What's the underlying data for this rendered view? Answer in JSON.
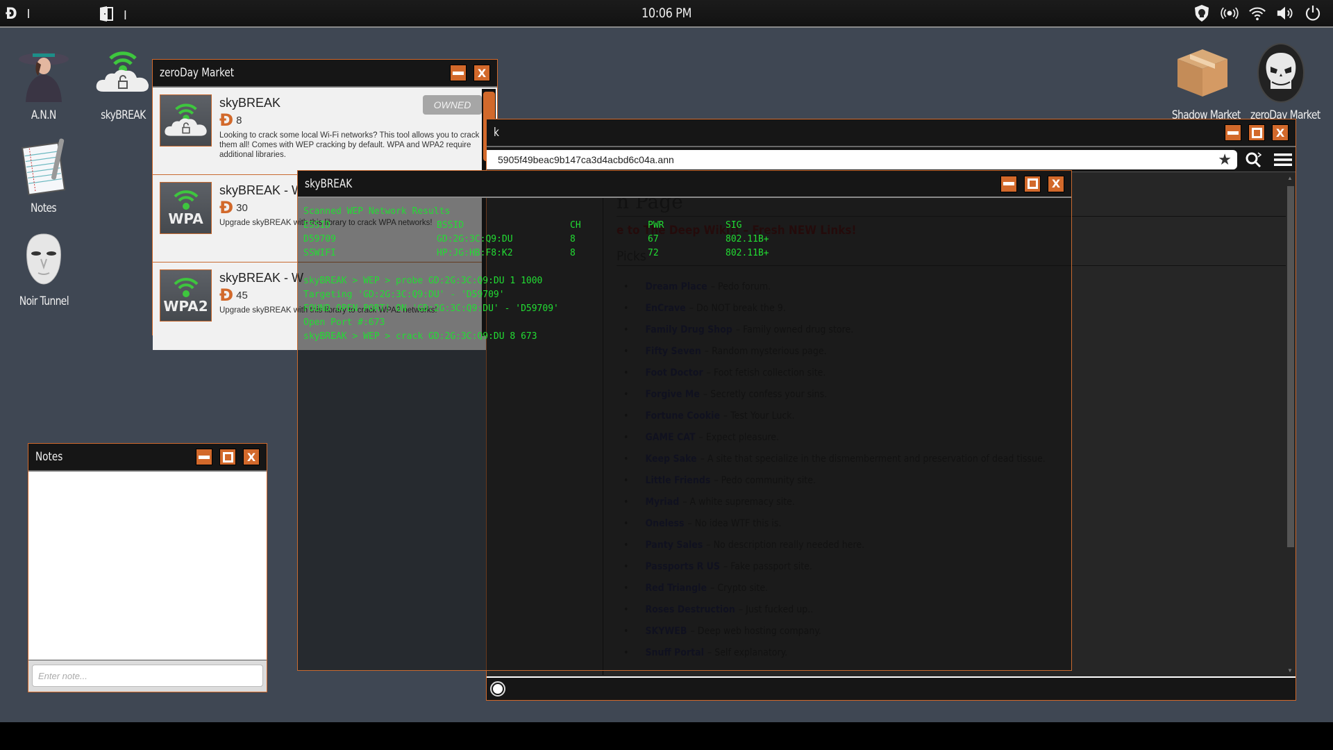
{
  "taskbar": {
    "left_items": [
      {
        "icon": "bitcoin-icon",
        "value": "I"
      },
      {
        "icon": "door-icon",
        "value": "I"
      }
    ],
    "clock": "10:06 PM",
    "tray_icons": [
      "shield-skull-icon",
      "broadcast-icon",
      "wifi-icon",
      "volume-icon",
      "power-icon"
    ]
  },
  "desktop": {
    "icons_left": [
      {
        "label": "A.N.N",
        "icon": "agent-icon"
      },
      {
        "label": "skyBREAK",
        "icon": "wifi-cloud-lock-icon"
      },
      {
        "label": "Notes",
        "icon": "notepad-icon"
      },
      {
        "label": "Noir Tunnel",
        "icon": "mask-icon"
      }
    ],
    "icons_right": [
      {
        "label": "Shadow Market",
        "icon": "package-icon"
      },
      {
        "label": "zeroDay Market",
        "icon": "skull-icon"
      }
    ]
  },
  "market_window": {
    "title": "zeroDay Market",
    "items": [
      {
        "name": "skyBREAK",
        "price": "8",
        "thumb_label": "",
        "description": "Looking to crack some local Wi-Fi networks? This tool allows you to crack them all! Comes with WEP cracking by default. WPA and WPA2 require additional libraries.",
        "status": "OWNED"
      },
      {
        "name": "skyBREAK - W",
        "price": "30",
        "thumb_label": "WPA",
        "description": "Upgrade skyBREAK with this library to crack WPA networks!"
      },
      {
        "name": "skyBREAK - W",
        "price": "45",
        "thumb_label": "WPA2",
        "description": "Upgrade skyBREAK with this library to crack WPA2 networks!"
      }
    ]
  },
  "browser_window": {
    "title_fragment": "k",
    "url": "5905f49beac9b147ca3d4acbd6c04a.ann",
    "page": {
      "heading_fragment": "n Page",
      "welcome_fragment": "e to The Deep Wiki!! – Fresh NEW Links!",
      "picks_heading_fragment": "Picks",
      "links": [
        {
          "name": "Dream Place",
          "desc": "– Pedo forum."
        },
        {
          "name": "EnCrave",
          "desc": "– Do NOT break the 9."
        },
        {
          "name": "Family Drug Shop",
          "desc": "– Family owned drug store."
        },
        {
          "name": "Fifty Seven",
          "desc": "– Random mysterious page."
        },
        {
          "name": "Foot Doctor",
          "desc": "– Foot fetish collection site."
        },
        {
          "name": "Forgive Me",
          "desc": "– Secretly confess your sins."
        },
        {
          "name": "Fortune Cookie",
          "desc": "– Test Your Luck."
        },
        {
          "name": "GAME CAT",
          "desc": "– Expect pleasure."
        },
        {
          "name": "Keep Sake",
          "desc": "– A site that specialize in the dismemberment and preservation of dead tissue."
        },
        {
          "name": "Little Friends",
          "desc": "– Pedo community site."
        },
        {
          "name": "Myriad",
          "desc": "– A white supremacy site."
        },
        {
          "name": "Oneless",
          "desc": "– No idea WTF this is."
        },
        {
          "name": "Panty Sales",
          "desc": "– No description really needed here."
        },
        {
          "name": "Passports R US",
          "desc": "– Fake passport site."
        },
        {
          "name": "Red Triangle",
          "desc": "– Crypto site."
        },
        {
          "name": "Roses Destruction",
          "desc": "– Just fucked up.."
        },
        {
          "name": "SKYWEB",
          "desc": "– Deep web hosting company."
        },
        {
          "name": "Snuff Portal",
          "desc": "– Self explanatory."
        }
      ]
    }
  },
  "terminal_window": {
    "title": "skyBREAK",
    "scan_header": "Scanned WEP Network Results",
    "columns": [
      "ESSID",
      "BSSID",
      "CH",
      "PWR",
      "SIG"
    ],
    "networks": [
      [
        "D59709",
        "GD:2G:3C:Q9:DU",
        "8",
        "67",
        "802.11B+"
      ],
      [
        "SSWIFI",
        "HP:JG:HB:F8:K2",
        "8",
        "72",
        "802.11B+"
      ]
    ],
    "log": [
      "skyBREAK > WEP > probe GD:2G:3C:Q9:DU 1 1000",
      "Targeting 'GD:2G:3C:Q9:DU' - 'D59709'",
      "FOUND OPEN PORT! ON 'GD:2G:3C:Q9:DU' - 'D59709'",
      "Open Port #:673",
      "skyBREAK > WEP > crack GD:2G:3C:Q9:DU 8 673"
    ]
  },
  "notes_window": {
    "title": "Notes",
    "input_placeholder": "Enter note...",
    "input_value": ""
  },
  "colors": {
    "accent": "#d2692b",
    "desktop_bg": "#3f4753",
    "terminal_text": "#22dd33",
    "titlebar": "#161616"
  }
}
